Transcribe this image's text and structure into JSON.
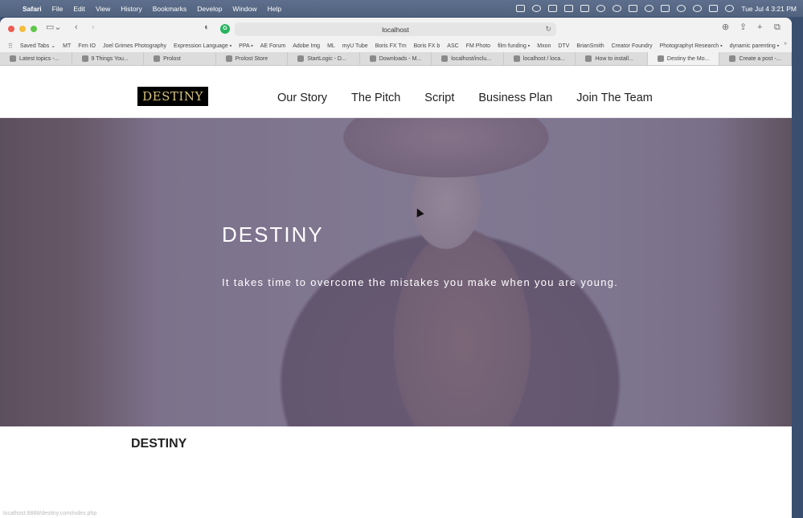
{
  "menubar": {
    "items": [
      "Safari",
      "File",
      "Edit",
      "View",
      "History",
      "Bookmarks",
      "Develop",
      "Window",
      "Help"
    ],
    "clock": "Tue Jul 4  3:21 PM"
  },
  "browser": {
    "address": "localhost",
    "favorites": [
      "Saved Tabs ⌄",
      "MT",
      "Frm IO",
      "Joel Grimes Photography",
      "Expression Language ▪",
      "PPA ▪",
      "AE Forum",
      "Adobe Img",
      "ML",
      "myU Tube",
      "Boris FX Trn",
      "Boris FX b",
      "ASC",
      "FM Photo",
      "film funding ▪",
      "Mxon",
      "DTV",
      "BrianSmith",
      "Creator Foundry",
      "Photographyt Research ▪",
      "dynamic parenting ▪"
    ],
    "tabs": [
      "Latest topics -...",
      "9 Things You...",
      "Prolost",
      "Prolost Store",
      "StartLogic - D...",
      "Downloads - M...",
      "localhost/inclu...",
      "localhost / loca...",
      "How to install...",
      "Destiny the Mo...",
      "Create a post -..."
    ],
    "active_tab": 9
  },
  "site": {
    "logo": "DESTINY",
    "nav": [
      "Our Story",
      "The Pitch",
      "Script",
      "Business Plan",
      "Join The Team"
    ],
    "hero": {
      "title": "DESTINY",
      "subtitle": "It takes time to overcome the mistakes you make when you are young."
    },
    "section_title": "DESTINY",
    "status_url": "localhost:8888/destiny.com/index.php"
  }
}
